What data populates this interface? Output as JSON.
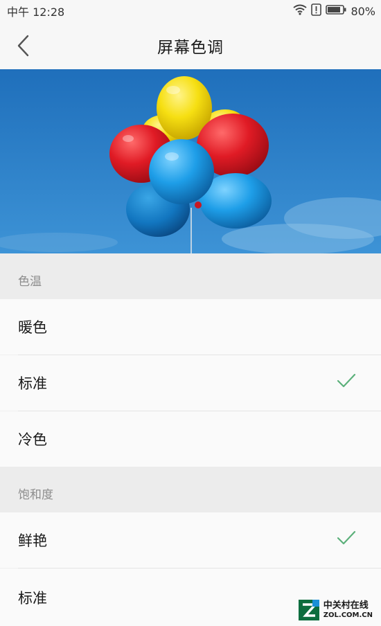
{
  "status_bar": {
    "time": "中午 12:28",
    "battery_percent": "80%",
    "icons": [
      "wifi-icon",
      "alert-icon",
      "battery-icon"
    ]
  },
  "header": {
    "title": "屏幕色调",
    "back_icon": "chevron-left-icon"
  },
  "hero_image": {
    "subject": "balloons"
  },
  "sections": {
    "color_temperature": {
      "title": "色温",
      "items": [
        {
          "label": "暖色",
          "selected": false
        },
        {
          "label": "标准",
          "selected": true
        },
        {
          "label": "冷色",
          "selected": false
        }
      ]
    },
    "saturation": {
      "title": "饱和度",
      "items": [
        {
          "label": "鲜艳",
          "selected": true
        },
        {
          "label": "标准",
          "selected": false
        }
      ]
    }
  },
  "colors": {
    "check": "#5bb07a",
    "sky": "#2a7fc4"
  },
  "watermark": {
    "cn": "中关村在线",
    "en": "ZOL.COM.CN"
  }
}
